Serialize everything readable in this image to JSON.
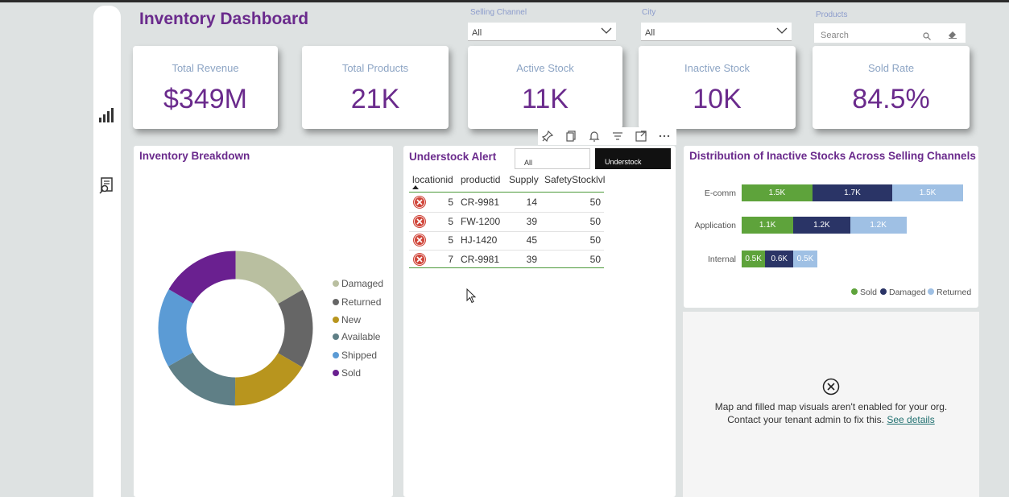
{
  "header": {
    "title": "Inventory Dashboard"
  },
  "slicers": {
    "selling_channel": {
      "label": "Selling Channel",
      "value": "All"
    },
    "city": {
      "label": "City",
      "value": "All"
    },
    "products": {
      "label": "Products",
      "placeholder": "Search"
    }
  },
  "kpis": [
    {
      "label": "Total Revenue",
      "value": "$349M"
    },
    {
      "label": "Total Products",
      "value": "21K"
    },
    {
      "label": "Active Stock",
      "value": "11K"
    },
    {
      "label": "Inactive Stock",
      "value": "10K"
    },
    {
      "label": "Sold Rate",
      "value": "84.5%"
    }
  ],
  "breakdown": {
    "title": "Inventory Breakdown",
    "legend": [
      {
        "label": "Damaged",
        "color": "#b9bfa0"
      },
      {
        "label": "Returned",
        "color": "#666666"
      },
      {
        "label": "New",
        "color": "#b8951e"
      },
      {
        "label": "Available",
        "color": "#5f7f86"
      },
      {
        "label": "Shipped",
        "color": "#5b9bd5"
      },
      {
        "label": "Sold",
        "color": "#6a2090"
      }
    ]
  },
  "chart_data": [
    {
      "type": "pie",
      "title": "Inventory Breakdown",
      "categories": [
        "Damaged",
        "Returned",
        "New",
        "Available",
        "Shipped",
        "Sold"
      ],
      "values": [
        16.7,
        16.7,
        16.7,
        16.7,
        16.6,
        16.6
      ]
    },
    {
      "type": "bar",
      "orientation": "horizontal",
      "stacked": true,
      "title": "Distribution of Inactive Stocks Across Selling Channels",
      "categories": [
        "E-comm",
        "Application",
        "Internal"
      ],
      "series": [
        {
          "name": "Sold",
          "color": "#5ea33b",
          "values": [
            1.5,
            1.1,
            0.5
          ],
          "labels": [
            "1.5K",
            "1.1K",
            "0.5K"
          ]
        },
        {
          "name": "Damaged",
          "color": "#2a3466",
          "values": [
            1.7,
            1.2,
            0.6
          ],
          "labels": [
            "1.7K",
            "1.2K",
            "0.6K"
          ]
        },
        {
          "name": "Returned",
          "color": "#9fc0e4",
          "values": [
            1.5,
            1.2,
            0.5
          ],
          "labels": [
            "1.5K",
            "1.2K",
            "0.5K"
          ]
        }
      ],
      "legend_position": "bottom-right"
    }
  ],
  "understock": {
    "title": "Understock Alert",
    "filter_all": "All",
    "filter_understock": "Understock",
    "columns": [
      "locationid",
      "productid",
      "Supply",
      "SafetyStocklvl"
    ],
    "rows": [
      [
        "5",
        "CR-9981",
        "14",
        "50"
      ],
      [
        "5",
        "FW-1200",
        "39",
        "50"
      ],
      [
        "5",
        "HJ-1420",
        "45",
        "50"
      ],
      [
        "7",
        "CR-9981",
        "39",
        "50"
      ]
    ]
  },
  "distribution": {
    "title": "Distribution of Inactive Stocks Across Selling Channels"
  },
  "map": {
    "line1": "Map and filled map visuals aren't enabled for your org.",
    "line2": "Contact your tenant admin to fix this.",
    "link": "See details"
  }
}
